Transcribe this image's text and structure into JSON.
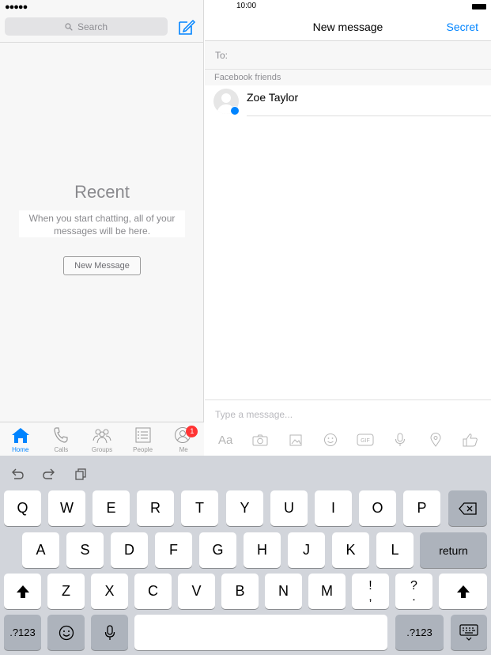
{
  "status": {
    "signal": "●●●●●",
    "time": "10:00"
  },
  "left": {
    "search_placeholder": "Search",
    "recent_title": "Recent",
    "recent_desc": "When you start chatting, all of your messages will be here.",
    "new_message_button": "New Message",
    "tabs": [
      {
        "label": "Home",
        "icon": "home-icon"
      },
      {
        "label": "Calls",
        "icon": "phone-icon"
      },
      {
        "label": "Groups",
        "icon": "groups-icon"
      },
      {
        "label": "People",
        "icon": "people-list-icon"
      },
      {
        "label": "Me",
        "icon": "profile-icon",
        "badge": "1"
      }
    ]
  },
  "right": {
    "title": "New message",
    "secret": "Secret",
    "to_label": "To:",
    "section_header": "Facebook friends",
    "friends": [
      {
        "name": "Zoe Taylor"
      }
    ],
    "message_placeholder": "Type a message...",
    "tools": [
      "Aa",
      "camera-icon",
      "photo-icon",
      "emoji-icon",
      "gif-icon",
      "mic-icon",
      "location-icon",
      "like-icon"
    ]
  },
  "keyboard": {
    "row1": [
      "Q",
      "W",
      "E",
      "R",
      "T",
      "Y",
      "U",
      "I",
      "O",
      "P"
    ],
    "row2": [
      "A",
      "S",
      "D",
      "F",
      "G",
      "H",
      "J",
      "K",
      "L"
    ],
    "row3": [
      "Z",
      "X",
      "C",
      "V",
      "B",
      "N",
      "M"
    ],
    "return": "return",
    "num_left": ".?123",
    "num_right": ".?123",
    "exclaim_top": "!",
    "exclaim_bottom": ",",
    "question_top": "?",
    "question_bottom": "."
  },
  "colors": {
    "accent": "#0084ff",
    "badge": "#ff3333"
  }
}
